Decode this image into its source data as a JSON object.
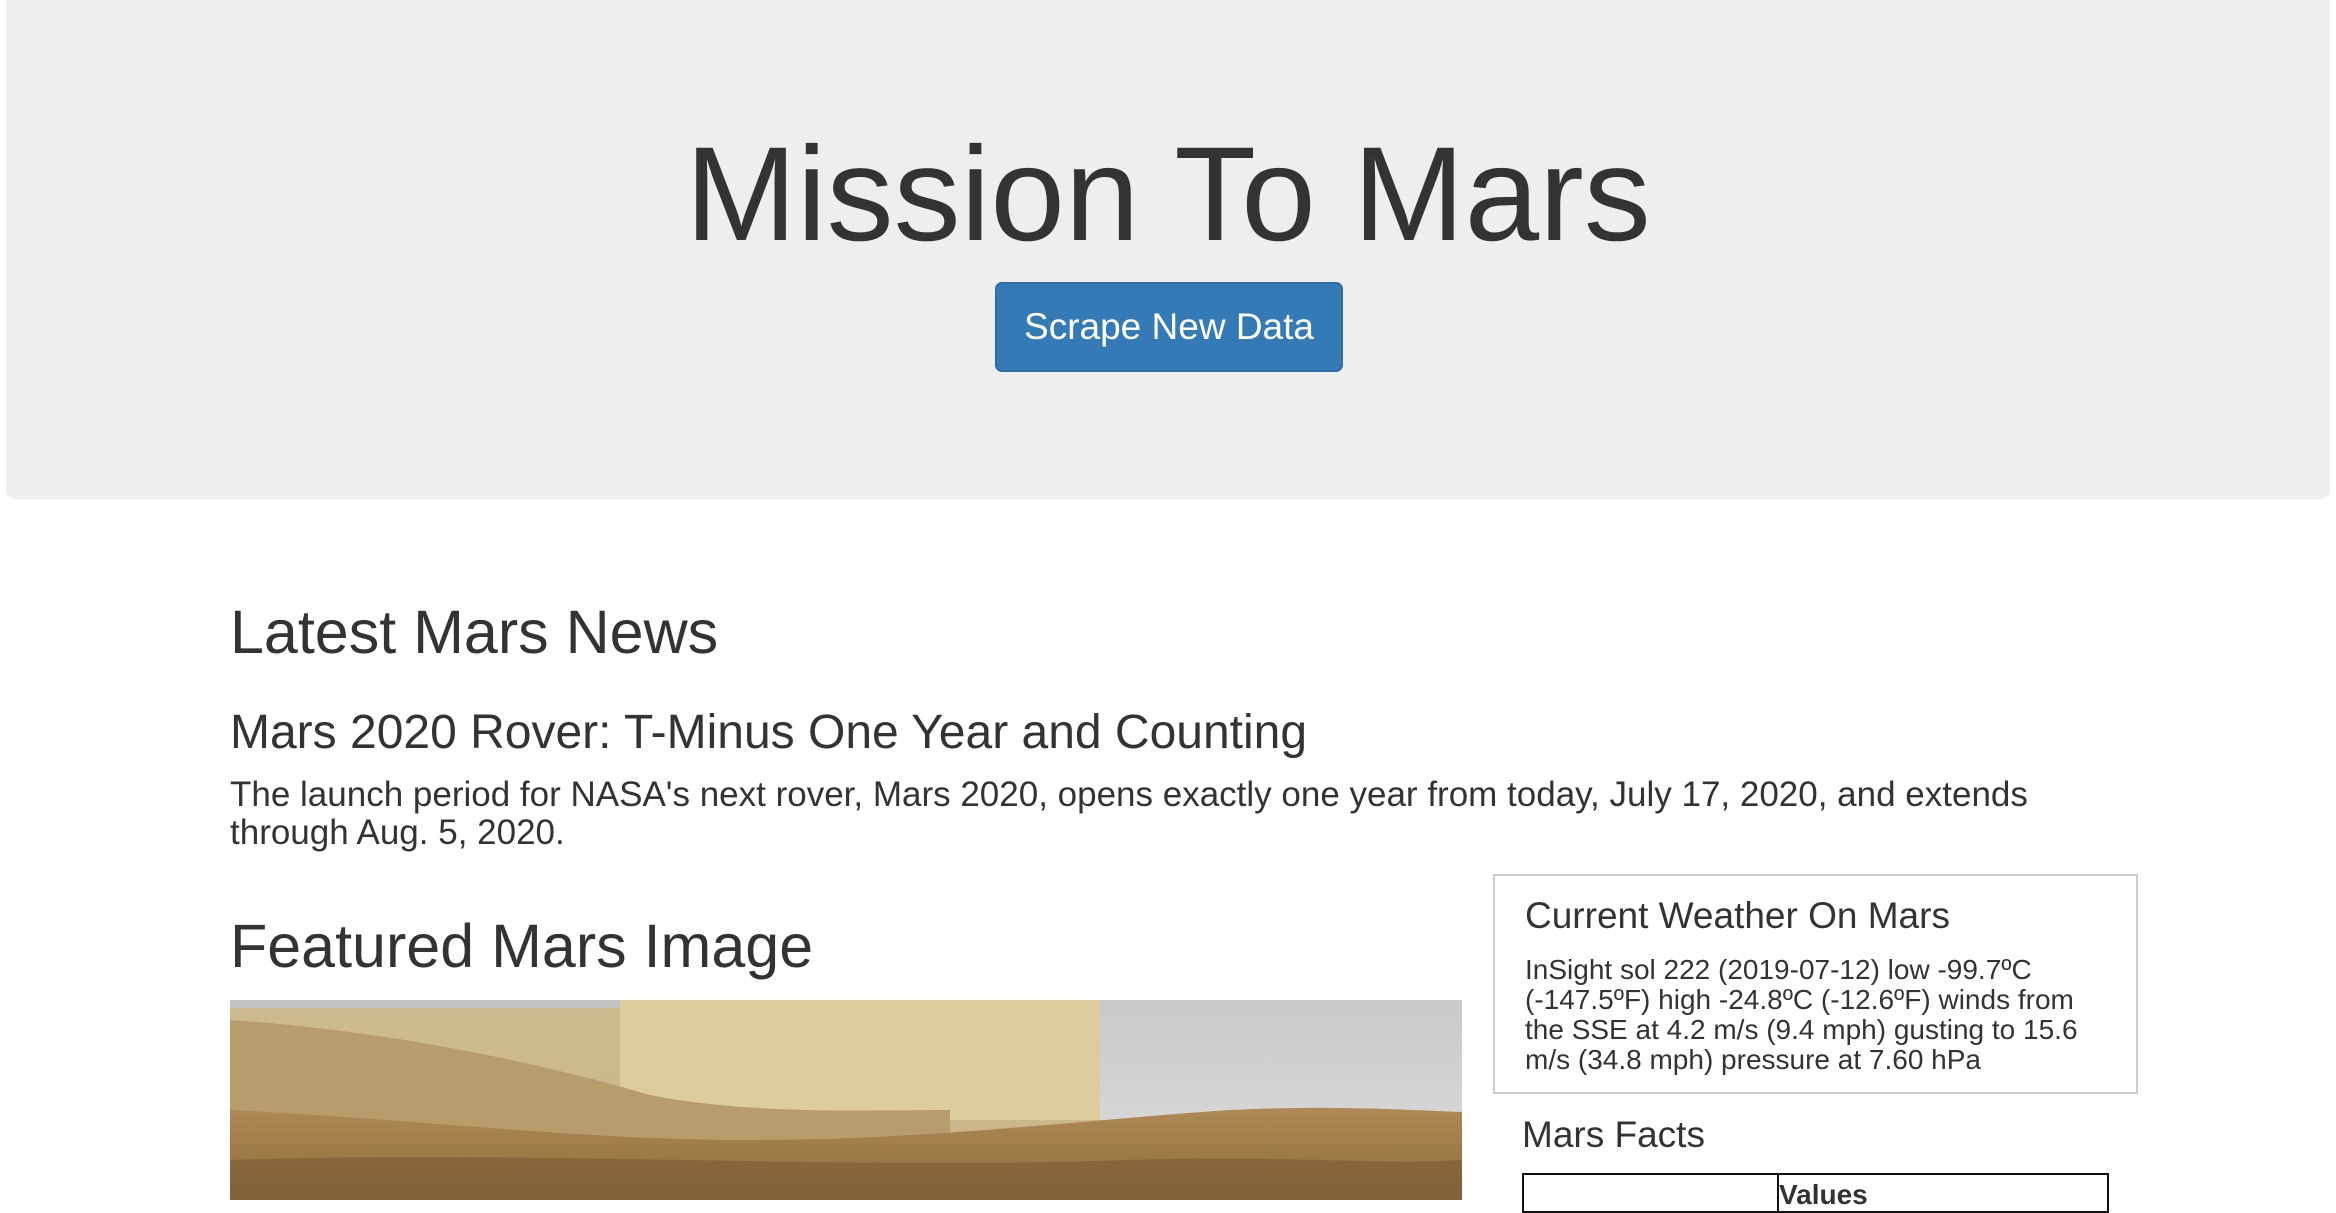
{
  "header": {
    "title": "Mission To Mars",
    "scrape_button_label": "Scrape New Data"
  },
  "news": {
    "section_heading": "Latest Mars News",
    "title": "Mars 2020 Rover: T-Minus One Year and Counting",
    "paragraph": "The launch period for NASA's next rover, Mars 2020, opens exactly one year from today, July 17, 2020, and extends through Aug. 5, 2020."
  },
  "featured_image": {
    "section_heading": "Featured Mars Image"
  },
  "weather": {
    "heading": "Current Weather On Mars",
    "text": "InSight sol 222 (2019-07-12) low -99.7ºC (-147.5ºF) high -24.8ºC (-12.6ºF) winds from the SSE at 4.2 m/s (9.4 mph) gusting to 15.6 m/s (34.8 mph) pressure at 7.60 hPa"
  },
  "facts": {
    "heading": "Mars Facts",
    "columns": [
      "",
      "Values"
    ]
  },
  "colors": {
    "jumbotron_bg": "#eeeeee",
    "button_bg": "#337ab7",
    "button_border": "#2e6da4",
    "text": "#333333"
  }
}
